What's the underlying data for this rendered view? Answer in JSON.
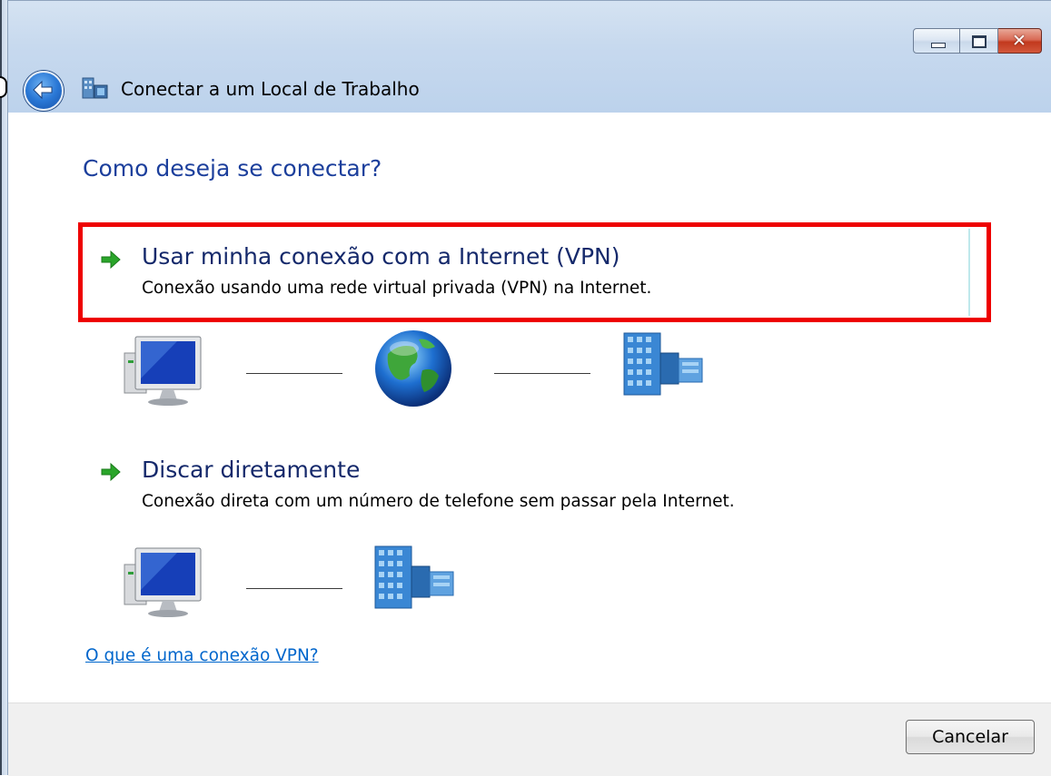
{
  "window": {
    "title": "Conectar a um Local de Trabalho",
    "heading": "Como deseja se conectar?"
  },
  "options": [
    {
      "title": "Usar minha conexão com a Internet (VPN)",
      "description": "Conexão usando uma rede virtual privada (VPN) na Internet.",
      "highlighted": true
    },
    {
      "title": "Discar diretamente",
      "description": "Conexão direta com um número de telefone sem passar pela Internet.",
      "highlighted": false
    }
  ],
  "help_link": "O que é uma conexão VPN?",
  "footer": {
    "cancel_label": "Cancelar"
  },
  "icons": {
    "back": "back-arrow-icon",
    "app": "workplace-network-icon",
    "option_arrow": "green-arrow-icon",
    "computer": "computer-monitor-icon",
    "globe": "globe-icon",
    "building": "office-building-icon"
  },
  "colors": {
    "heading": "#1c3f9c",
    "option_title": "#15296b",
    "link": "#0066cc",
    "highlight_border": "#ee0000",
    "arrow": "#2aa52a"
  }
}
